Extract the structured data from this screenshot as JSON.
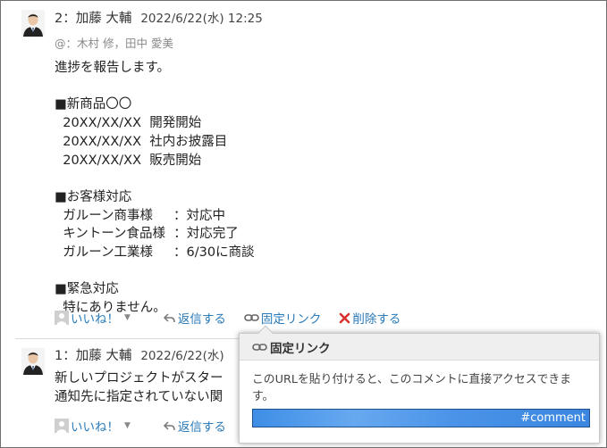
{
  "comments": [
    {
      "number": "2",
      "author": "加藤 大輔",
      "date": "2022/6/22(水) 12:25",
      "mention": "@：木村 修，田中 愛美",
      "body": "進捗を報告します。\n\n■新商品〇〇\n  20XX/XX/XX  開発開始\n  20XX/XX/XX  社内お披露目\n  20XX/XX/XX  販売開始\n\n■お客様対応\n  ガルーン商事様     ：対応中\n  キントーン食品様  ：対応完了\n  ガルーン工業様     ：6/30に商談\n\n■緊急対応\n  特にありません。"
    },
    {
      "number": "1",
      "author": "加藤 大輔",
      "date": "2022/6/22(水)",
      "body": "新しいプロジェクトがスター\n通知先に指定されていない関"
    }
  ],
  "actions": {
    "like": "いいね！",
    "reply": "返信する",
    "permalink": "固定リンク",
    "delete": "削除する"
  },
  "popup": {
    "title": "固定リンク",
    "description": "このURLを貼り付けると、このコメントに直接アクセスできます。",
    "url_value": "#comment"
  },
  "colors": {
    "link": "#2a7ab8",
    "delete_icon": "#d9332f",
    "url_selection": "#4a93e8"
  }
}
